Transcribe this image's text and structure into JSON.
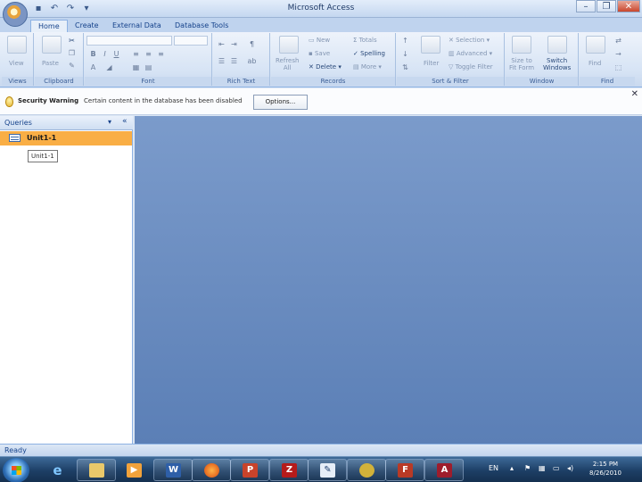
{
  "window": {
    "title": "Microsoft Access",
    "controls": [
      "minimize-icon",
      "maximize-icon",
      "close-icon"
    ]
  },
  "quick_access": [
    "save-icon",
    "undo-icon",
    "redo-icon",
    "customize-icon"
  ],
  "tabs": [
    {
      "label": "Home",
      "active": true
    },
    {
      "label": "Create",
      "active": false
    },
    {
      "label": "External Data",
      "active": false
    },
    {
      "label": "Database Tools",
      "active": false
    }
  ],
  "ribbon": {
    "views": {
      "group": "Views",
      "view_label": "View"
    },
    "clipboard": {
      "group": "Clipboard",
      "paste_label": "Paste"
    },
    "font": {
      "group": "Font",
      "bold": "B",
      "italic": "I",
      "underline": "U"
    },
    "rich_text": {
      "group": "Rich Text"
    },
    "records": {
      "group": "Records",
      "refresh_label": "Refresh\nAll",
      "new_label": "New",
      "save_label": "Save",
      "delete_label": "Delete",
      "totals_label": "Totals",
      "spelling_label": "Spelling",
      "more_label": "More"
    },
    "sort_filter": {
      "group": "Sort & Filter",
      "filter_label": "Filter",
      "selection_label": "Selection",
      "advanced_label": "Advanced",
      "toggle_filter_label": "Toggle Filter"
    },
    "window": {
      "group": "Window",
      "size_to_fit_label": "Size to\nFit Form",
      "switch_windows_label": "Switch\nWindows"
    },
    "find": {
      "group": "Find",
      "find_label": "Find"
    }
  },
  "message_bar": {
    "title": "Security Warning",
    "text": "Certain content in the database has been disabled",
    "options_label": "Options..."
  },
  "nav_pane": {
    "title": "Queries",
    "items": [
      {
        "label": "Unit1-1",
        "selected": true
      }
    ],
    "tooltip": "Unit1-1"
  },
  "status": {
    "text": "Ready"
  },
  "taskbar": {
    "apps": [
      "internet-explorer-icon",
      "explorer-folder-icon",
      "media-player-icon",
      "word-icon",
      "firefox-icon",
      "powerpoint-icon",
      "filezilla-icon",
      "app-icon",
      "tool-icon",
      "flash-icon",
      "access-icon"
    ],
    "language": "EN",
    "time": "2:15 PM",
    "date": "8/26/2010"
  }
}
